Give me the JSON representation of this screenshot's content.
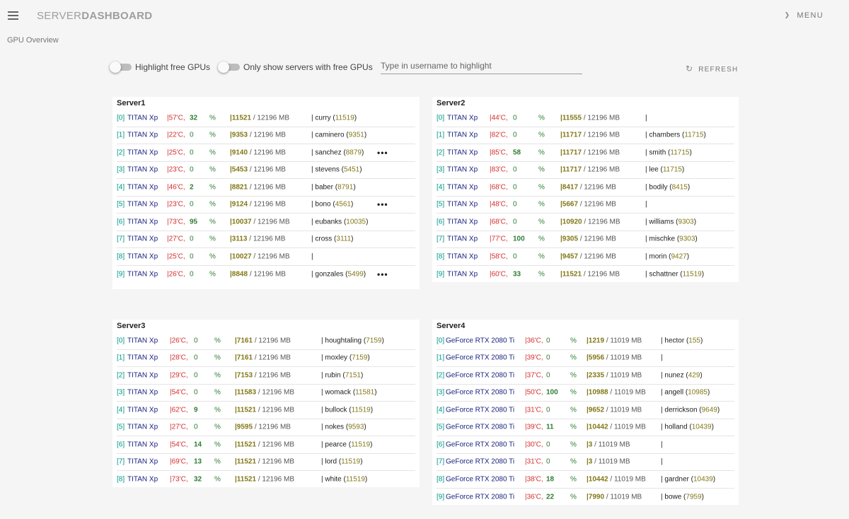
{
  "header": {
    "brand_light": "SERVER",
    "brand_bold": "DASHBOARD",
    "menu_label": "MENU"
  },
  "page_subtitle": "GPU Overview",
  "controls": {
    "highlight_free_label": "Highlight free GPUs",
    "only_free_label": "Only show servers with free GPUs",
    "username_placeholder": "Type in username to highlight",
    "username_value": "",
    "refresh_label": "REFRESH"
  },
  "colors": {
    "accent_index": "#009688",
    "gpu_name": "#1a237e",
    "temperature": "#d32f2f",
    "utilization": "#2e7d32",
    "memory": "#827717"
  },
  "icons": {
    "menu": "hamburger-icon",
    "menu_chevron": "chevron-down-icon",
    "refresh": "refresh-icon",
    "more": "more-horizontal-icon"
  },
  "servers": [
    {
      "name": "Server1",
      "gpus": [
        {
          "idx": "[0]",
          "name": "TITAN Xp",
          "temp": "|57'C,",
          "util": "32",
          "pct": "%",
          "mem_used": "|11521",
          "mem_total": " / 12196 MB",
          "users": "| curry (",
          "users_mem": "11519",
          "users_end": ")",
          "more": ""
        },
        {
          "idx": "[1]",
          "name": "TITAN Xp",
          "temp": "|22'C,",
          "util": "0",
          "pct": "%",
          "mem_used": "|9353",
          "mem_total": " / 12196 MB",
          "users": "| caminero (",
          "users_mem": "9351",
          "users_end": ")",
          "more": ""
        },
        {
          "idx": "[2]",
          "name": "TITAN Xp",
          "temp": "|25'C,",
          "util": "0",
          "pct": "%",
          "mem_used": "|9140",
          "mem_total": " / 12196 MB",
          "users": "| sanchez (",
          "users_mem": "8879",
          "users_end": ")",
          "more": "•••"
        },
        {
          "idx": "[3]",
          "name": "TITAN Xp",
          "temp": "|23'C,",
          "util": "0",
          "pct": "%",
          "mem_used": "|5453",
          "mem_total": " / 12196 MB",
          "users": "| stevens (",
          "users_mem": "5451",
          "users_end": ")",
          "more": ""
        },
        {
          "idx": "[4]",
          "name": "TITAN Xp",
          "temp": "|46'C,",
          "util": "2",
          "pct": "%",
          "mem_used": "|8821",
          "mem_total": " / 12196 MB",
          "users": "| baber (",
          "users_mem": "8791",
          "users_end": ")",
          "more": ""
        },
        {
          "idx": "[5]",
          "name": "TITAN Xp",
          "temp": "|23'C,",
          "util": "0",
          "pct": "%",
          "mem_used": "|9124",
          "mem_total": " / 12196 MB",
          "users": "| bono (",
          "users_mem": "4561",
          "users_end": ")",
          "more": "•••"
        },
        {
          "idx": "[6]",
          "name": "TITAN Xp",
          "temp": "|73'C,",
          "util": "95",
          "pct": "%",
          "mem_used": "|10037",
          "mem_total": " / 12196 MB",
          "users": "| eubanks (",
          "users_mem": "10035",
          "users_end": ")",
          "more": ""
        },
        {
          "idx": "[7]",
          "name": "TITAN Xp",
          "temp": "|27'C,",
          "util": "0",
          "pct": "%",
          "mem_used": "|3113",
          "mem_total": " / 12196 MB",
          "users": "| cross (",
          "users_mem": "3111",
          "users_end": ")",
          "more": ""
        },
        {
          "idx": "[8]",
          "name": "TITAN Xp",
          "temp": "|25'C,",
          "util": "0",
          "pct": "%",
          "mem_used": "|10027",
          "mem_total": " / 12196 MB",
          "users": "|",
          "users_mem": "",
          "users_end": "",
          "more": ""
        },
        {
          "idx": "[9]",
          "name": "TITAN Xp",
          "temp": "|26'C,",
          "util": "0",
          "pct": "%",
          "mem_used": "|8848",
          "mem_total": " / 12196 MB",
          "users": "| gonzales (",
          "users_mem": "5499",
          "users_end": ")",
          "more": "•••"
        }
      ]
    },
    {
      "name": "Server2",
      "gpus": [
        {
          "idx": "[0]",
          "name": "TITAN Xp",
          "temp": "|44'C,",
          "util": "0",
          "pct": "%",
          "mem_used": "|11555",
          "mem_total": " / 12196 MB",
          "users": "|",
          "users_mem": "",
          "users_end": "",
          "more": ""
        },
        {
          "idx": "[1]",
          "name": "TITAN Xp",
          "temp": "|82'C,",
          "util": "0",
          "pct": "%",
          "mem_used": "|11717",
          "mem_total": " / 12196 MB",
          "users": "| chambers (",
          "users_mem": "11715",
          "users_end": ")",
          "more": ""
        },
        {
          "idx": "[2]",
          "name": "TITAN Xp",
          "temp": "|85'C,",
          "util": "58",
          "pct": "%",
          "mem_used": "|11717",
          "mem_total": " / 12196 MB",
          "users": "| smith (",
          "users_mem": "11715",
          "users_end": ")",
          "more": ""
        },
        {
          "idx": "[3]",
          "name": "TITAN Xp",
          "temp": "|83'C,",
          "util": "0",
          "pct": "%",
          "mem_used": "|11717",
          "mem_total": " / 12196 MB",
          "users": "| lee (",
          "users_mem": "11715",
          "users_end": ")",
          "more": ""
        },
        {
          "idx": "[4]",
          "name": "TITAN Xp",
          "temp": "|68'C,",
          "util": "0",
          "pct": "%",
          "mem_used": "|8417",
          "mem_total": " / 12196 MB",
          "users": "| bodily (",
          "users_mem": "8415",
          "users_end": ")",
          "more": ""
        },
        {
          "idx": "[5]",
          "name": "TITAN Xp",
          "temp": "|48'C,",
          "util": "0",
          "pct": "%",
          "mem_used": "|5667",
          "mem_total": " / 12196 MB",
          "users": "|",
          "users_mem": "",
          "users_end": "",
          "more": ""
        },
        {
          "idx": "[6]",
          "name": "TITAN Xp",
          "temp": "|68'C,",
          "util": "0",
          "pct": "%",
          "mem_used": "|10920",
          "mem_total": " / 12196 MB",
          "users": "| williams (",
          "users_mem": "9303",
          "users_end": ")",
          "more": ""
        },
        {
          "idx": "[7]",
          "name": "TITAN Xp",
          "temp": "|77'C,",
          "util": "100",
          "pct": "%",
          "mem_used": "|9305",
          "mem_total": " / 12196 MB",
          "users": "| mischke (",
          "users_mem": "9303",
          "users_end": ")",
          "more": ""
        },
        {
          "idx": "[8]",
          "name": "TITAN Xp",
          "temp": "|58'C,",
          "util": "0",
          "pct": "%",
          "mem_used": "|9457",
          "mem_total": " / 12196 MB",
          "users": "| morin (",
          "users_mem": "9427",
          "users_end": ")",
          "more": ""
        },
        {
          "idx": "[9]",
          "name": "TITAN Xp",
          "temp": "|60'C,",
          "util": "33",
          "pct": "%",
          "mem_used": "|11521",
          "mem_total": " / 12196 MB",
          "users": "| schattner (",
          "users_mem": "11519",
          "users_end": ")",
          "more": ""
        }
      ]
    },
    {
      "name": "Server3",
      "gpus": [
        {
          "idx": "[0]",
          "name": "TITAN Xp",
          "temp": "|26'C,",
          "util": "0",
          "pct": "%",
          "mem_used": "|7161",
          "mem_total": " / 12196 MB",
          "users": "| houghtaling (",
          "users_mem": "7159",
          "users_end": ")",
          "more": ""
        },
        {
          "idx": "[1]",
          "name": "TITAN Xp",
          "temp": "|28'C,",
          "util": "0",
          "pct": "%",
          "mem_used": "|7161",
          "mem_total": " / 12196 MB",
          "users": "| moxley (",
          "users_mem": "7159",
          "users_end": ")",
          "more": ""
        },
        {
          "idx": "[2]",
          "name": "TITAN Xp",
          "temp": "|29'C,",
          "util": "0",
          "pct": "%",
          "mem_used": "|7153",
          "mem_total": " / 12196 MB",
          "users": "| rubin (",
          "users_mem": "7151",
          "users_end": ")",
          "more": ""
        },
        {
          "idx": "[3]",
          "name": "TITAN Xp",
          "temp": "|54'C,",
          "util": "0",
          "pct": "%",
          "mem_used": "|11583",
          "mem_total": " / 12196 MB",
          "users": "| womack (",
          "users_mem": "11581",
          "users_end": ")",
          "more": ""
        },
        {
          "idx": "[4]",
          "name": "TITAN Xp",
          "temp": "|62'C,",
          "util": "9",
          "pct": "%",
          "mem_used": "|11521",
          "mem_total": " / 12196 MB",
          "users": "| bullock (",
          "users_mem": "11519",
          "users_end": ")",
          "more": ""
        },
        {
          "idx": "[5]",
          "name": "TITAN Xp",
          "temp": "|27'C,",
          "util": "0",
          "pct": "%",
          "mem_used": "|9595",
          "mem_total": " / 12196 MB",
          "users": "| nokes (",
          "users_mem": "9593",
          "users_end": ")",
          "more": ""
        },
        {
          "idx": "[6]",
          "name": "TITAN Xp",
          "temp": "|54'C,",
          "util": "14",
          "pct": "%",
          "mem_used": "|11521",
          "mem_total": " / 12196 MB",
          "users": "| pearce (",
          "users_mem": "11519",
          "users_end": ")",
          "more": ""
        },
        {
          "idx": "[7]",
          "name": "TITAN Xp",
          "temp": "|69'C,",
          "util": "13",
          "pct": "%",
          "mem_used": "|11521",
          "mem_total": " / 12196 MB",
          "users": "| lord (",
          "users_mem": "11519",
          "users_end": ")",
          "more": ""
        },
        {
          "idx": "[8]",
          "name": "TITAN Xp",
          "temp": "|73'C,",
          "util": "32",
          "pct": "%",
          "mem_used": "|11521",
          "mem_total": " / 12196 MB",
          "users": "| white (",
          "users_mem": "11519",
          "users_end": ")",
          "more": ""
        }
      ]
    },
    {
      "name": "Server4",
      "gpus": [
        {
          "idx": "[0]",
          "name": "GeForce RTX 2080 Ti",
          "temp": "|36'C,",
          "util": "0",
          "pct": "%",
          "mem_used": "|1219",
          "mem_total": " / 11019 MB",
          "users": "| hector (",
          "users_mem": "155",
          "users_end": ")",
          "more": ""
        },
        {
          "idx": "[1]",
          "name": "GeForce RTX 2080 Ti",
          "temp": "|39'C,",
          "util": "0",
          "pct": "%",
          "mem_used": "|5956",
          "mem_total": " / 11019 MB",
          "users": "|",
          "users_mem": "",
          "users_end": "",
          "more": ""
        },
        {
          "idx": "[2]",
          "name": "GeForce RTX 2080 Ti",
          "temp": "|37'C,",
          "util": "0",
          "pct": "%",
          "mem_used": "|2335",
          "mem_total": " / 11019 MB",
          "users": "| nunez (",
          "users_mem": "429",
          "users_end": ")",
          "more": ""
        },
        {
          "idx": "[3]",
          "name": "GeForce RTX 2080 Ti",
          "temp": "|50'C,",
          "util": "100",
          "pct": "%",
          "mem_used": "|10988",
          "mem_total": " / 11019 MB",
          "users": "| angell (",
          "users_mem": "10985",
          "users_end": ")",
          "more": ""
        },
        {
          "idx": "[4]",
          "name": "GeForce RTX 2080 Ti",
          "temp": "|31'C,",
          "util": "0",
          "pct": "%",
          "mem_used": "|9652",
          "mem_total": " / 11019 MB",
          "users": "| derrickson (",
          "users_mem": "9649",
          "users_end": ")",
          "more": ""
        },
        {
          "idx": "[5]",
          "name": "GeForce RTX 2080 Ti",
          "temp": "|39'C,",
          "util": "11",
          "pct": "%",
          "mem_used": "|10442",
          "mem_total": " / 11019 MB",
          "users": "| holland (",
          "users_mem": "10439",
          "users_end": ")",
          "more": ""
        },
        {
          "idx": "[6]",
          "name": "GeForce RTX 2080 Ti",
          "temp": "|30'C,",
          "util": "0",
          "pct": "%",
          "mem_used": "|3",
          "mem_total": " / 11019 MB",
          "users": "|",
          "users_mem": "",
          "users_end": "",
          "more": ""
        },
        {
          "idx": "[7]",
          "name": "GeForce RTX 2080 Ti",
          "temp": "|31'C,",
          "util": "0",
          "pct": "%",
          "mem_used": "|3",
          "mem_total": " / 11019 MB",
          "users": "|",
          "users_mem": "",
          "users_end": "",
          "more": ""
        },
        {
          "idx": "[8]",
          "name": "GeForce RTX 2080 Ti",
          "temp": "|38'C,",
          "util": "18",
          "pct": "%",
          "mem_used": "|10442",
          "mem_total": " / 11019 MB",
          "users": "| gardner (",
          "users_mem": "10439",
          "users_end": ")",
          "more": ""
        },
        {
          "idx": "[9]",
          "name": "GeForce RTX 2080 Ti",
          "temp": "|36'C,",
          "util": "22",
          "pct": "%",
          "mem_used": "|7990",
          "mem_total": " / 11019 MB",
          "users": "| bowe (",
          "users_mem": "7959",
          "users_end": ")",
          "more": ""
        }
      ]
    }
  ]
}
